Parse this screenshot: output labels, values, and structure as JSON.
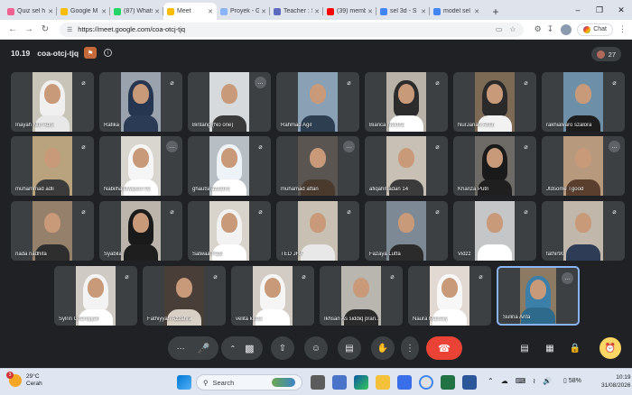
{
  "browser": {
    "tabs": [
      {
        "label": "Quiz sel h",
        "color": "#f06292"
      },
      {
        "label": "Google M",
        "color": "#fbbc04"
      },
      {
        "label": "(87) Whats",
        "color": "#25d366"
      },
      {
        "label": "Meet",
        "color": "#fbbc04",
        "active": true
      },
      {
        "label": "Proyek - G",
        "color": "#8ab4f8"
      },
      {
        "label": "Teacher : S",
        "color": "#5c6bc0"
      },
      {
        "label": "(39) memb",
        "color": "#ff0000"
      },
      {
        "label": "sel 3d - S",
        "color": "#4285f4"
      },
      {
        "label": "model sel",
        "color": "#4285f4"
      }
    ],
    "new_tab": "+",
    "url": "https://meet.google.com/coa-otcj-tjq",
    "chat_label": "Chat"
  },
  "meet": {
    "time": "10.19",
    "code": "coa-otcj-tjq",
    "participant_count": "27",
    "participants": [
      {
        "name": "Inayah Nur Adni",
        "mute": true,
        "bgColor": "#c9c4b8",
        "clothing": "#e8e8e8",
        "hijab": "#f0f0f0"
      },
      {
        "name": "Rafika",
        "mute": true,
        "bgColor": "#9aa3ad",
        "clothing": "#2b3a55",
        "hijab": "#263650"
      },
      {
        "name": "Bintang (No one)",
        "mute": false,
        "bgColor": "#d7dadc",
        "clothing": "#3a3a3a",
        "hijab": ""
      },
      {
        "name": "Rahmad Agil",
        "mute": true,
        "bgColor": "#8aa0b5",
        "clothing": "#2c3e50",
        "hijab": ""
      },
      {
        "name": "Bianca Neldha",
        "mute": true,
        "bgColor": "#b8b2a8",
        "clothing": "#ffffff",
        "hijab": "#2c2c2c"
      },
      {
        "name": "NurJanah Arifin",
        "mute": true,
        "bgColor": "#7d6a55",
        "clothing": "#f2f2f2",
        "hijab": "#2a2a2a"
      },
      {
        "name": "rakhialvaro szalora",
        "mute": true,
        "bgColor": "#6e8fa8",
        "clothing": "#1d1d1d",
        "hijab": ""
      },
      {
        "name": "muhammad adli",
        "mute": true,
        "bgColor": "#b9a37f",
        "clothing": "#3b3b3b",
        "hijab": ""
      },
      {
        "name": "Nabilha Dwiputri 02",
        "mute": false,
        "bgColor": "#d9d5cf",
        "clothing": "#ffffff",
        "hijab": "#f5f5f5"
      },
      {
        "name": "ghautsi azzahro",
        "mute": true,
        "bgColor": "#b7bec4",
        "clothing": "#ffffff",
        "hijab": "#eef3f8"
      },
      {
        "name": "muhamad atfan",
        "mute": false,
        "bgColor": "#5a5550",
        "clothing": "#4a3a2e",
        "hijab": ""
      },
      {
        "name": "afiqahmadan 14",
        "mute": true,
        "bgColor": "#c8c0b5",
        "clothing": "#3b3b3b",
        "hijab": ""
      },
      {
        "name": "Khanza Putri",
        "mute": true,
        "bgColor": "#6e6b66",
        "clothing": "#1f1f1f",
        "hijab": "#1a1a1a"
      },
      {
        "name": "Jtdsome Tgood",
        "mute": false,
        "bgColor": "#b79a7e",
        "clothing": "#5a3f2e",
        "hijab": ""
      },
      {
        "name": "nada nadhifa",
        "mute": true,
        "bgColor": "#94806b",
        "clothing": "#2e2e2e",
        "hijab": ""
      },
      {
        "name": "Syabila",
        "mute": true,
        "bgColor": "#bbb5ac",
        "clothing": "#1e1e1e",
        "hijab": "#1a1a1a"
      },
      {
        "name": "Salwaa Fazil",
        "mute": true,
        "bgColor": "#d8d4cc",
        "clothing": "#ffffff",
        "hijab": "#f2f2f2"
      },
      {
        "name": "TED JHA",
        "mute": true,
        "bgColor": "#c7c0b3",
        "clothing": "#e8e8e8",
        "hijab": ""
      },
      {
        "name": "Fazaya Lutfa",
        "mute": true,
        "bgColor": "#7d8a95",
        "clothing": "#2b2b2b",
        "hijab": ""
      },
      {
        "name": "Vidzz",
        "mute": true,
        "bgColor": "#c4c6c8",
        "clothing": "#ffffff",
        "hijab": ""
      },
      {
        "name": "fathir90",
        "mute": true,
        "bgColor": "#c1b7aa",
        "clothing": "#2f3c55",
        "hijab": ""
      },
      {
        "name": "Sylrin Ghaniyyah",
        "mute": true,
        "bgColor": "#cfcac3",
        "clothing": "#ffffff",
        "hijab": "#f3f3f3"
      },
      {
        "name": "Fathiyyah Azzahra",
        "mute": true,
        "bgColor": "#4a3f38",
        "clothing": "#d8cfc5",
        "hijab": ""
      },
      {
        "name": "velita kinza",
        "mute": true,
        "bgColor": "#d2ccc4",
        "clothing": "#ffffff",
        "hijab": "#f5f5f5"
      },
      {
        "name": "Ikhsan As siddiq pran...",
        "mute": true,
        "bgColor": "#b9b6b0",
        "clothing": "#2b2b2b",
        "hijab": ""
      },
      {
        "name": "Naura Maisary",
        "mute": true,
        "bgColor": "#e3d9d3",
        "clothing": "#ffffff",
        "hijab": "#f7f7f7"
      },
      {
        "name": "Sulina Arifa",
        "mute": false,
        "bgColor": "#8c7a63",
        "clothing": "#2d6a8c",
        "hijab": "#3c7fa8",
        "self": true
      }
    ]
  },
  "controls": {
    "more_icon": "more-dots",
    "mic_icon": "mic",
    "camera_icon": "camera",
    "present_icon": "present",
    "emoji_icon": "emoji",
    "captions_icon": "captions",
    "raise_hand_icon": "raise-hand",
    "options_icon": "vertical-dots",
    "leave_icon": "hang-up",
    "hang_color": "#ea4335"
  },
  "taskbar": {
    "temperature": "29°C",
    "weather": "Cerah",
    "weather_badge": "3",
    "search_placeholder": "Search",
    "battery": "58%",
    "time": "10:19",
    "date": "31/08/2026"
  }
}
